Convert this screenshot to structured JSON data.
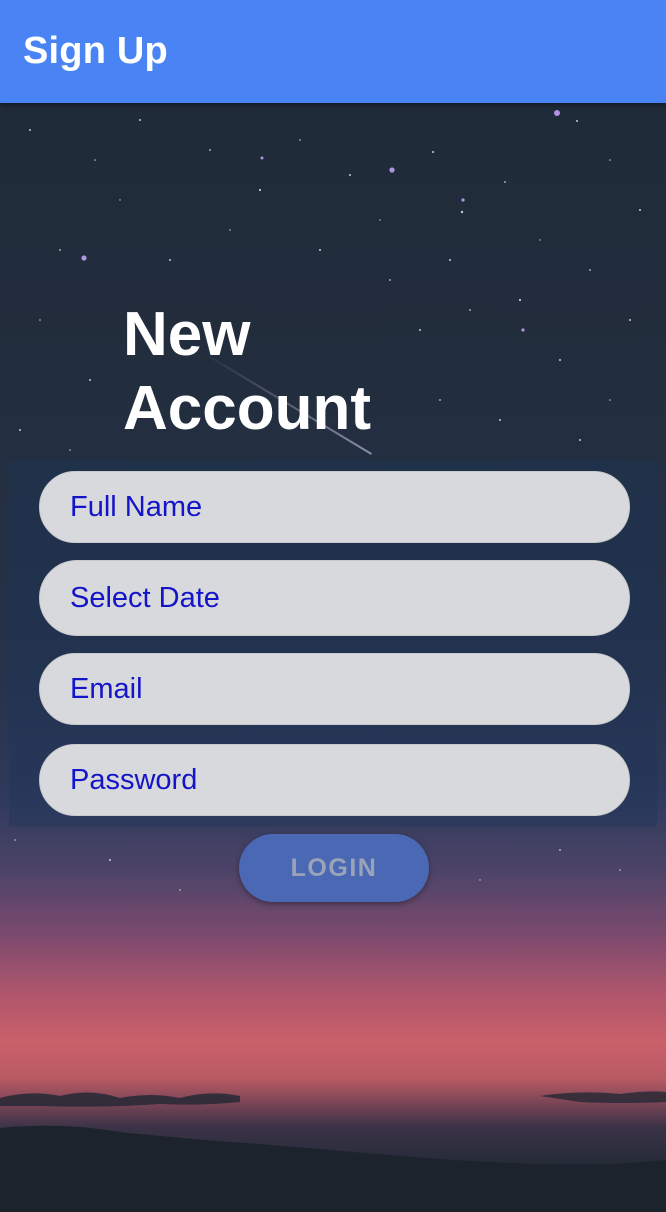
{
  "appbar": {
    "title": "Sign Up",
    "color": "#4a84f4"
  },
  "heading": {
    "line1": "New",
    "line2": "Account"
  },
  "form": {
    "full_name_placeholder": "Full Name",
    "date_placeholder": "Select Date",
    "email_placeholder": "Email",
    "password_placeholder": "Password",
    "placeholder_color": "#1414c8"
  },
  "login_button": {
    "label": "LOGIN",
    "disabled": true
  }
}
